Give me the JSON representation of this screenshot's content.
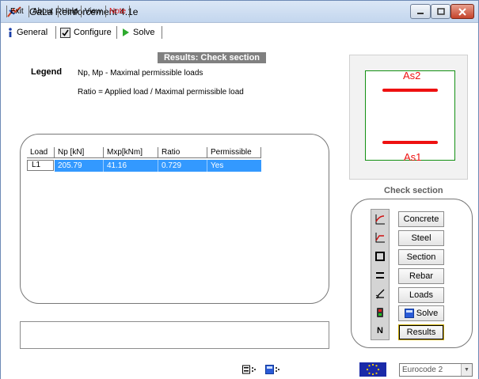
{
  "window": {
    "title": "GaLa Reinforcement  4.1e"
  },
  "tabs": [
    {
      "label": "General"
    },
    {
      "label": "Configure"
    },
    {
      "label": "Solve"
    }
  ],
  "results": {
    "heading": "Results: Check section",
    "legend_title": "Legend",
    "legend_line1": "Np, Mp  - Maximal permissible loads",
    "legend_line2": "Ratio  =  Applied load / Maximal permissible load"
  },
  "table": {
    "columns": [
      "Load",
      "Np [kN]",
      "Mxp[kNm]",
      "Ratio",
      "Permissible"
    ],
    "rows": [
      {
        "load": "L1",
        "np": "205.79",
        "mxp": "41.16",
        "ratio": "0.729",
        "permissible": "Yes"
      }
    ]
  },
  "section_preview": {
    "top_label": "As2",
    "bottom_label": "As1"
  },
  "check_section": {
    "title": "Check section",
    "buttons": [
      {
        "label": "Concrete",
        "icon": "concrete-icon"
      },
      {
        "label": "Steel",
        "icon": "steel-icon"
      },
      {
        "label": "Section",
        "icon": "section-icon"
      },
      {
        "label": "Rebar",
        "icon": "rebar-icon"
      },
      {
        "label": "Loads",
        "icon": "loads-icon"
      },
      {
        "label": "Solve",
        "icon": "solve-icon"
      },
      {
        "label": "Results",
        "icon": "results-icon"
      }
    ],
    "icon_column_last_glyph": "N"
  },
  "bottom": {
    "exit": "Exit",
    "about": "About",
    "help": "Help",
    "view": "View",
    "note": "Note",
    "code_select": "Eurocode 2"
  },
  "colors": {
    "accent_selection": "#3399ff",
    "rebar": "#ee1111",
    "section_outline": "#139013",
    "note_text": "#e01010"
  }
}
